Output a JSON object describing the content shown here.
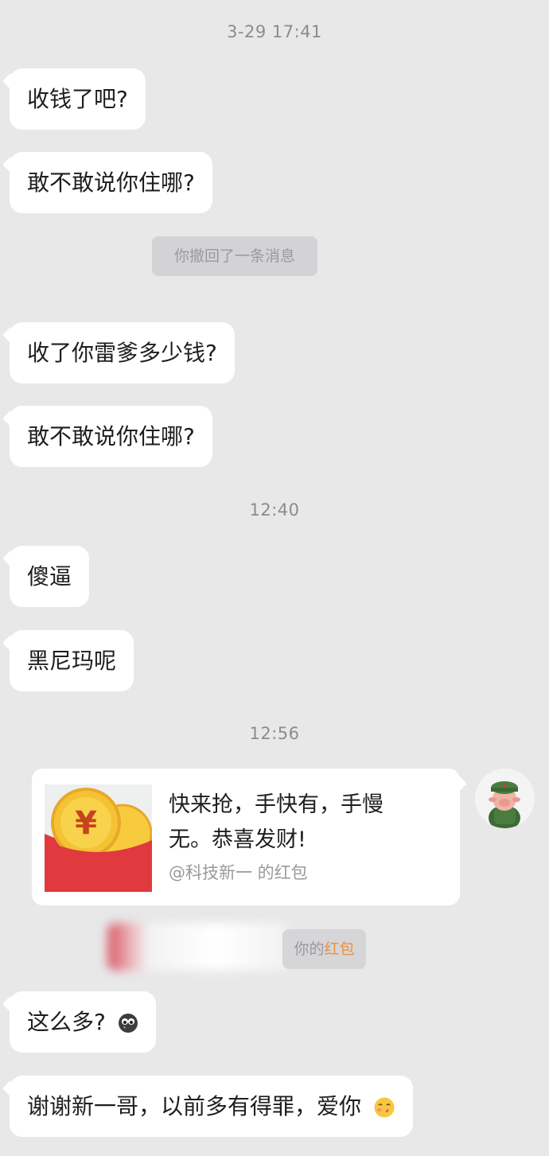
{
  "timestamps": [
    "3-29 17:41",
    "12:40",
    "12:56"
  ],
  "messages": {
    "m1": "收钱了吧?",
    "m2": "敢不敢说你住哪?",
    "m3": "收了你雷爹多少钱?",
    "m4": "敢不敢说你住哪?",
    "m5": "傻逼",
    "m6": "黑尼玛呢",
    "m7": "这么多?",
    "m8": "谢谢新一哥，以前多有得罪，爱你"
  },
  "system": {
    "recall": "你撤回了一条消息",
    "received_prefix": "你的",
    "received_link": "红包"
  },
  "redpacket": {
    "line1": "快来抢，手快有，手慢",
    "line2": "无。恭喜发财!",
    "from": "@科技新一 的红包",
    "symbol": "¥"
  },
  "colors": {
    "background": "#e8e8e9",
    "bubble": "#ffffff",
    "redpacket_red": "#e03a3f",
    "redpacket_gold": "#f5c233",
    "link_orange": "#e9923c"
  },
  "icons": {
    "m7_emoji": "tearful-face-icon",
    "m8_emoji": "kissing-face-icon"
  }
}
